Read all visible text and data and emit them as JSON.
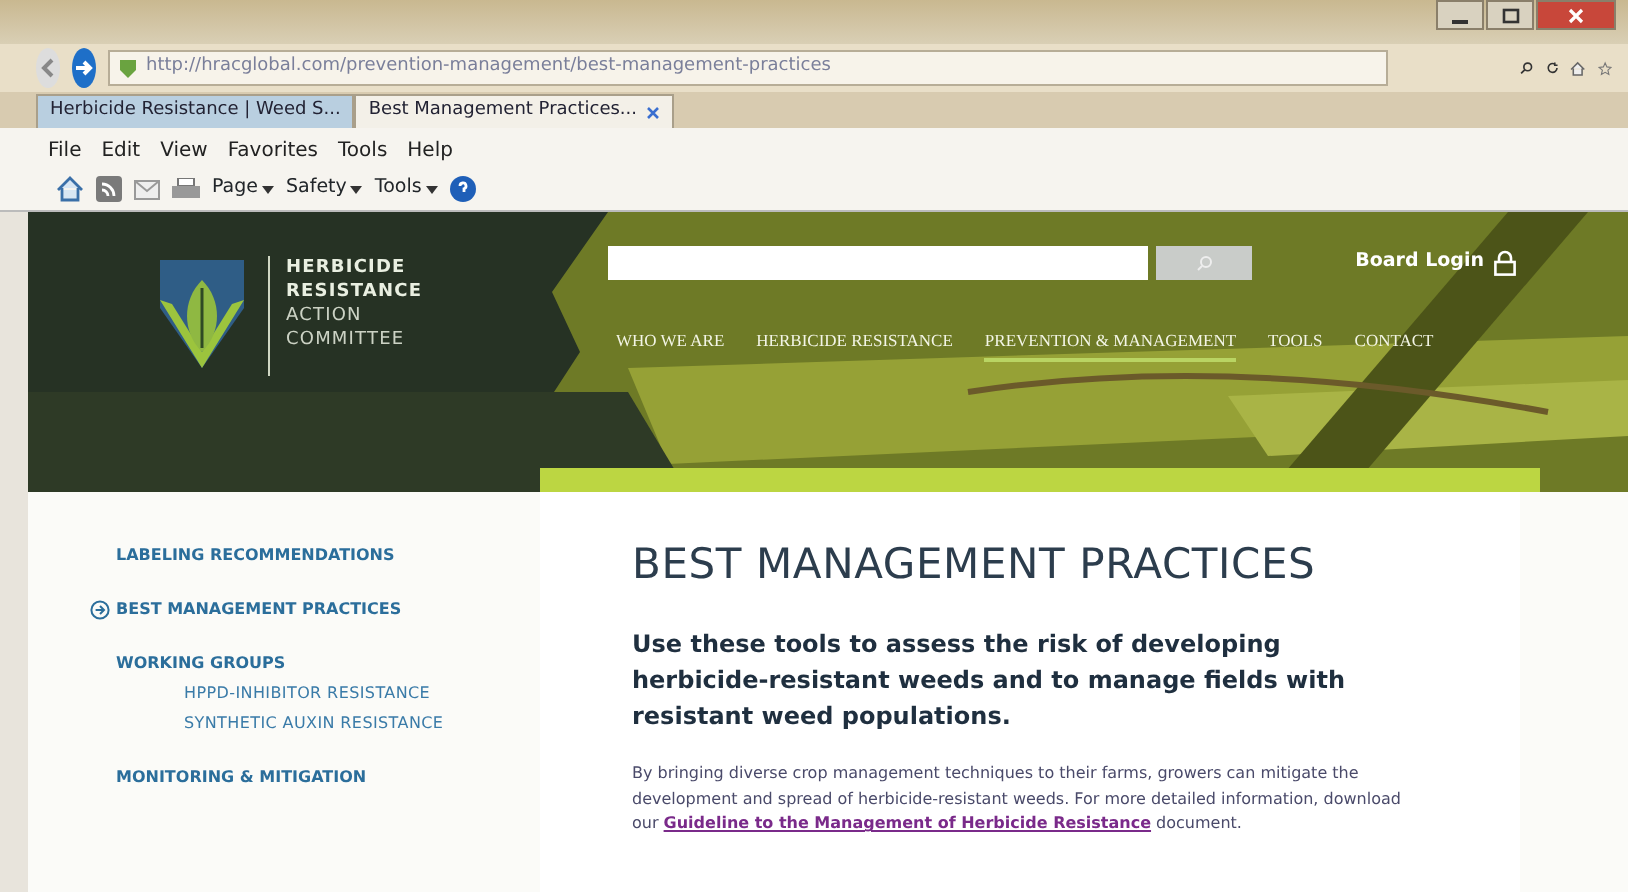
{
  "browser": {
    "url": "http://hracglobal.com/prevention-management/best-management-practices",
    "tabs": [
      {
        "label": "Herbicide Resistance | Weed S...",
        "selected": false
      },
      {
        "label": "Best Management Practices...",
        "selected": true
      }
    ],
    "menu": [
      "File",
      "Edit",
      "View",
      "Favorites",
      "Tools",
      "Help"
    ],
    "commands": [
      "Page",
      "Safety",
      "Tools"
    ]
  },
  "site": {
    "logo_lines": [
      {
        "text": "HERBICIDE",
        "bold": true
      },
      {
        "text": "RESISTANCE",
        "bold": true
      },
      {
        "text": "ACTION",
        "bold": false
      },
      {
        "text": "COMMITTEE",
        "bold": false
      }
    ],
    "login": "Board Login",
    "nav": [
      {
        "label": "WHO WE ARE",
        "selected": false
      },
      {
        "label": "HERBICIDE RESISTANCE",
        "selected": false
      },
      {
        "label": "PREVENTION & MANAGEMENT",
        "selected": true
      },
      {
        "label": "TOOLS",
        "selected": false
      },
      {
        "label": "CONTACT",
        "selected": false
      }
    ]
  },
  "sidebar": [
    {
      "label": "LABELING RECOMMENDATIONS",
      "selected": false
    },
    {
      "label": "BEST MANAGEMENT PRACTICES",
      "selected": true
    },
    {
      "label": "WORKING GROUPS",
      "selected": false,
      "children": [
        {
          "label": "HPPD-INHIBITOR RESISTANCE",
          "selected": false
        },
        {
          "label": "SYNTHETIC AUXIN RESISTANCE",
          "selected": false
        }
      ]
    },
    {
      "label": "MONITORING & MITIGATION",
      "selected": false
    }
  ],
  "content": {
    "title": "BEST MANAGEMENT PRACTICES",
    "lead": "Use these tools to assess the risk of developing herbicide-resistant weeds and to manage fields with resistant weed populations.",
    "body_before": "By bringing diverse crop management techniques to their farms, growers can mitigate the development and spread of herbicide-resistant weeds. For more detailed information, download our",
    "body_link": "Guideline to the Management of Herbicide Resistance",
    "body_after": "document."
  }
}
